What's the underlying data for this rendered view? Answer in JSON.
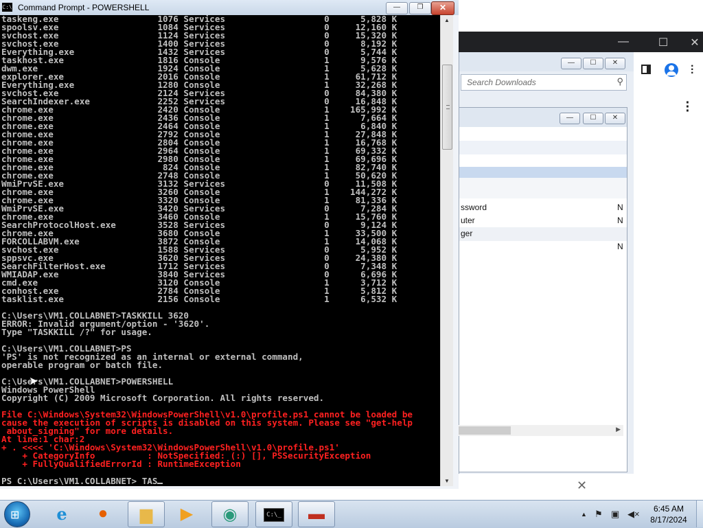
{
  "cmd_window": {
    "title": "Command Prompt - POWERSHELL",
    "icon_label": "C:\\",
    "close_label": "✕",
    "process_lines": [
      "taskeng.exe                   1076 Services                   0      5,828 K",
      "spoolsv.exe                   1084 Services                   0     12,160 K",
      "svchost.exe                   1124 Services                   0     15,320 K",
      "svchost.exe                   1400 Services                   0      8,192 K",
      "Everything.exe                1432 Services                   0      5,744 K",
      "taskhost.exe                  1816 Console                    1      9,576 K",
      "dwm.exe                       1924 Console                    1      5,628 K",
      "explorer.exe                  2016 Console                    1     61,712 K",
      "Everything.exe                1280 Console                    1     32,268 K",
      "svchost.exe                   2124 Services                   0     84,380 K",
      "SearchIndexer.exe             2252 Services                   0     16,848 K",
      "chrome.exe                    2420 Console                    1    165,992 K",
      "chrome.exe                    2436 Console                    1      7,664 K",
      "chrome.exe                    2464 Console                    1      6,840 K",
      "chrome.exe                    2792 Console                    1     27,848 K",
      "chrome.exe                    2804 Console                    1     16,768 K",
      "chrome.exe                    2964 Console                    1     69,332 K",
      "chrome.exe                    2980 Console                    1     69,696 K",
      "chrome.exe                     824 Console                    1     82,740 K",
      "chrome.exe                    2748 Console                    1     50,620 K",
      "WmiPrvSE.exe                  3132 Services                   0     11,508 K",
      "chrome.exe                    3260 Console                    1    144,272 K",
      "chrome.exe                    3320 Console                    1     81,336 K",
      "WmiPrvSE.exe                  3420 Services                   0      7,284 K",
      "chrome.exe                    3460 Console                    1     15,760 K",
      "SearchProtocolHost.exe        3528 Services                   0      9,124 K",
      "chrome.exe                    3680 Console                    1     33,500 K",
      "FORCOLLABVM.exe               3872 Console                    1     14,068 K",
      "svchost.exe                   1588 Services                   0      5,952 K",
      "sppsvc.exe                    3620 Services                   0     24,380 K",
      "SearchFilterHost.exe          1712 Services                   0      7,348 K",
      "WMIADAP.exe                   3840 Services                   0      6,696 K",
      "cmd.exe                       3120 Console                    1      3,712 K",
      "conhost.exe                   2784 Console                    1      5,812 K",
      "tasklist.exe                  2156 Console                    1      6,532 K"
    ],
    "after_lines": [
      "",
      "C:\\Users\\VM1.COLLABNET>TASKKILL 3620",
      "ERROR: Invalid argument/option - '3620'.",
      "Type \"TASKKILL /?\" for usage.",
      "",
      "C:\\Users\\VM1.COLLABNET>PS",
      "'PS' is not recognized as an internal or external command,",
      "operable program or batch file.",
      "",
      "C:\\Users\\VM1.COLLABNET>POWERSHELL",
      "Windows PowerShell",
      "Copyright (C) 2009 Microsoft Corporation. All rights reserved.",
      ""
    ],
    "error_lines": [
      "File C:\\Windows\\System32\\WindowsPowerShell\\v1.0\\profile.ps1 cannot be loaded be",
      "cause the execution of scripts is disabled on this system. Please see \"get-help",
      " about_signing\" for more details.",
      "At line:1 char:2",
      "+ . <<<< 'C:\\Windows\\System32\\WindowsPowerShell\\v1.0\\profile.ps1'",
      "    + CategoryInfo          : NotSpecified: (:) [], PSSecurityException",
      "    + FullyQualifiedErrorId : RuntimeException"
    ],
    "prompt": "PS C:\\Users\\VM1.COLLABNET> TAS"
  },
  "background": {
    "search_placeholder": "Search Downloads",
    "rows": [
      {
        "label": "ssword",
        "flag": "N"
      },
      {
        "label": "uter",
        "flag": "N"
      },
      {
        "label": "ger",
        "flag": ""
      },
      {
        "label": "",
        "flag": "N"
      }
    ]
  },
  "taskbar": {
    "clock_time": "6:45 AM",
    "clock_date": "8/17/2024"
  },
  "colors": {
    "console_bg": "#000000",
    "console_text": "#c0c0c0",
    "error_text": "#ff2020",
    "taskbar": "#c9d8ea"
  }
}
